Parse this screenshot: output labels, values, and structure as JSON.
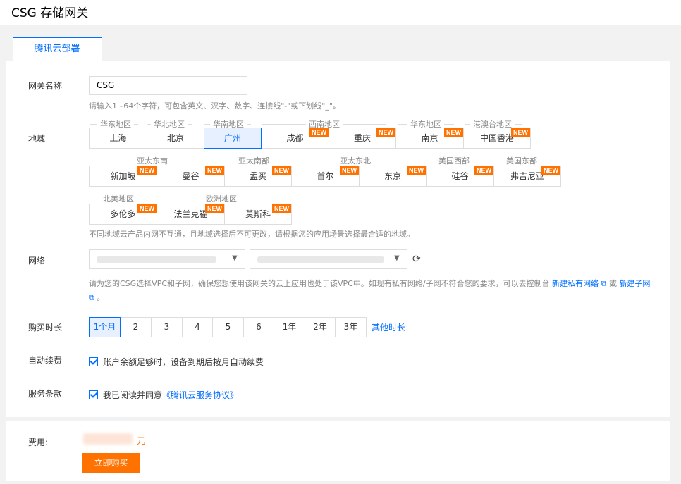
{
  "page": {
    "title": "CSG 存储网关"
  },
  "tabs": [
    {
      "label": "腾讯云部署"
    }
  ],
  "form": {
    "gateway_name": {
      "label": "网关名称",
      "value": "CSG",
      "hint": "请输入1~64个字符，可包含英文、汉字、数字、连接线\"-\"或下划线\"_\"。"
    },
    "region": {
      "label": "地域",
      "selected": "广州",
      "new_badge": "NEW",
      "groups": [
        {
          "name": "华东地区",
          "items": [
            "上海"
          ]
        },
        {
          "name": "华北地区",
          "items": [
            "北京"
          ]
        },
        {
          "name": "华南地区",
          "items": [
            "广州"
          ]
        },
        {
          "name": "西南地区",
          "items": [
            "成都",
            "重庆"
          ]
        },
        {
          "name": "华东地区",
          "items": [
            "南京"
          ]
        },
        {
          "name": "港澳台地区",
          "items": [
            "中国香港"
          ]
        },
        {
          "name": "亚太东南",
          "items": [
            "新加坡",
            "曼谷"
          ]
        },
        {
          "name": "亚太南部",
          "items": [
            "孟买"
          ]
        },
        {
          "name": "亚太东北",
          "items": [
            "首尔",
            "东京"
          ]
        },
        {
          "name": "美国西部",
          "items": [
            "硅谷"
          ]
        },
        {
          "name": "美国东部",
          "items": [
            "弗吉尼亚"
          ]
        },
        {
          "name": "北美地区",
          "items": [
            "多伦多"
          ]
        },
        {
          "name": "欧洲地区",
          "items": [
            "法兰克福",
            "莫斯科"
          ]
        }
      ],
      "hint": "不同地域云产品内网不互通，且地域选择后不可更改，请根据您的应用场景选择最合适的地域。"
    },
    "network": {
      "label": "网络",
      "icons": {
        "dropdown": "chevron-down-icon",
        "refresh": "refresh-icon",
        "external": "external-link-icon"
      },
      "hint_text": "请为您的CSG选择VPC和子网，确保您想使用该网关的云上应用也处于该VPC中。如现有私有网络/子网不符合您的要求，可以去控制台",
      "link_new_vpc": "新建私有网络",
      "or_text": "或",
      "link_new_subnet": "新建子网",
      "hint_end": "。"
    },
    "duration": {
      "label": "购买时长",
      "options": [
        "1个月",
        "2",
        "3",
        "4",
        "5",
        "6",
        "1年",
        "2年",
        "3年"
      ],
      "selected": "1个月",
      "other_link": "其他时长"
    },
    "auto_renew": {
      "label": "自动续费",
      "checkbox_text": "账户余额足够时，设备到期后按月自动续费"
    },
    "terms": {
      "label": "服务条款",
      "prefix": "我已阅读并同意",
      "link": "《腾讯云服务协议》"
    }
  },
  "footer": {
    "fee_label": "费用:",
    "unit": "元",
    "buy_button": "立即购买"
  },
  "colors": {
    "accent": "#006eff",
    "orange": "#ff7200"
  }
}
